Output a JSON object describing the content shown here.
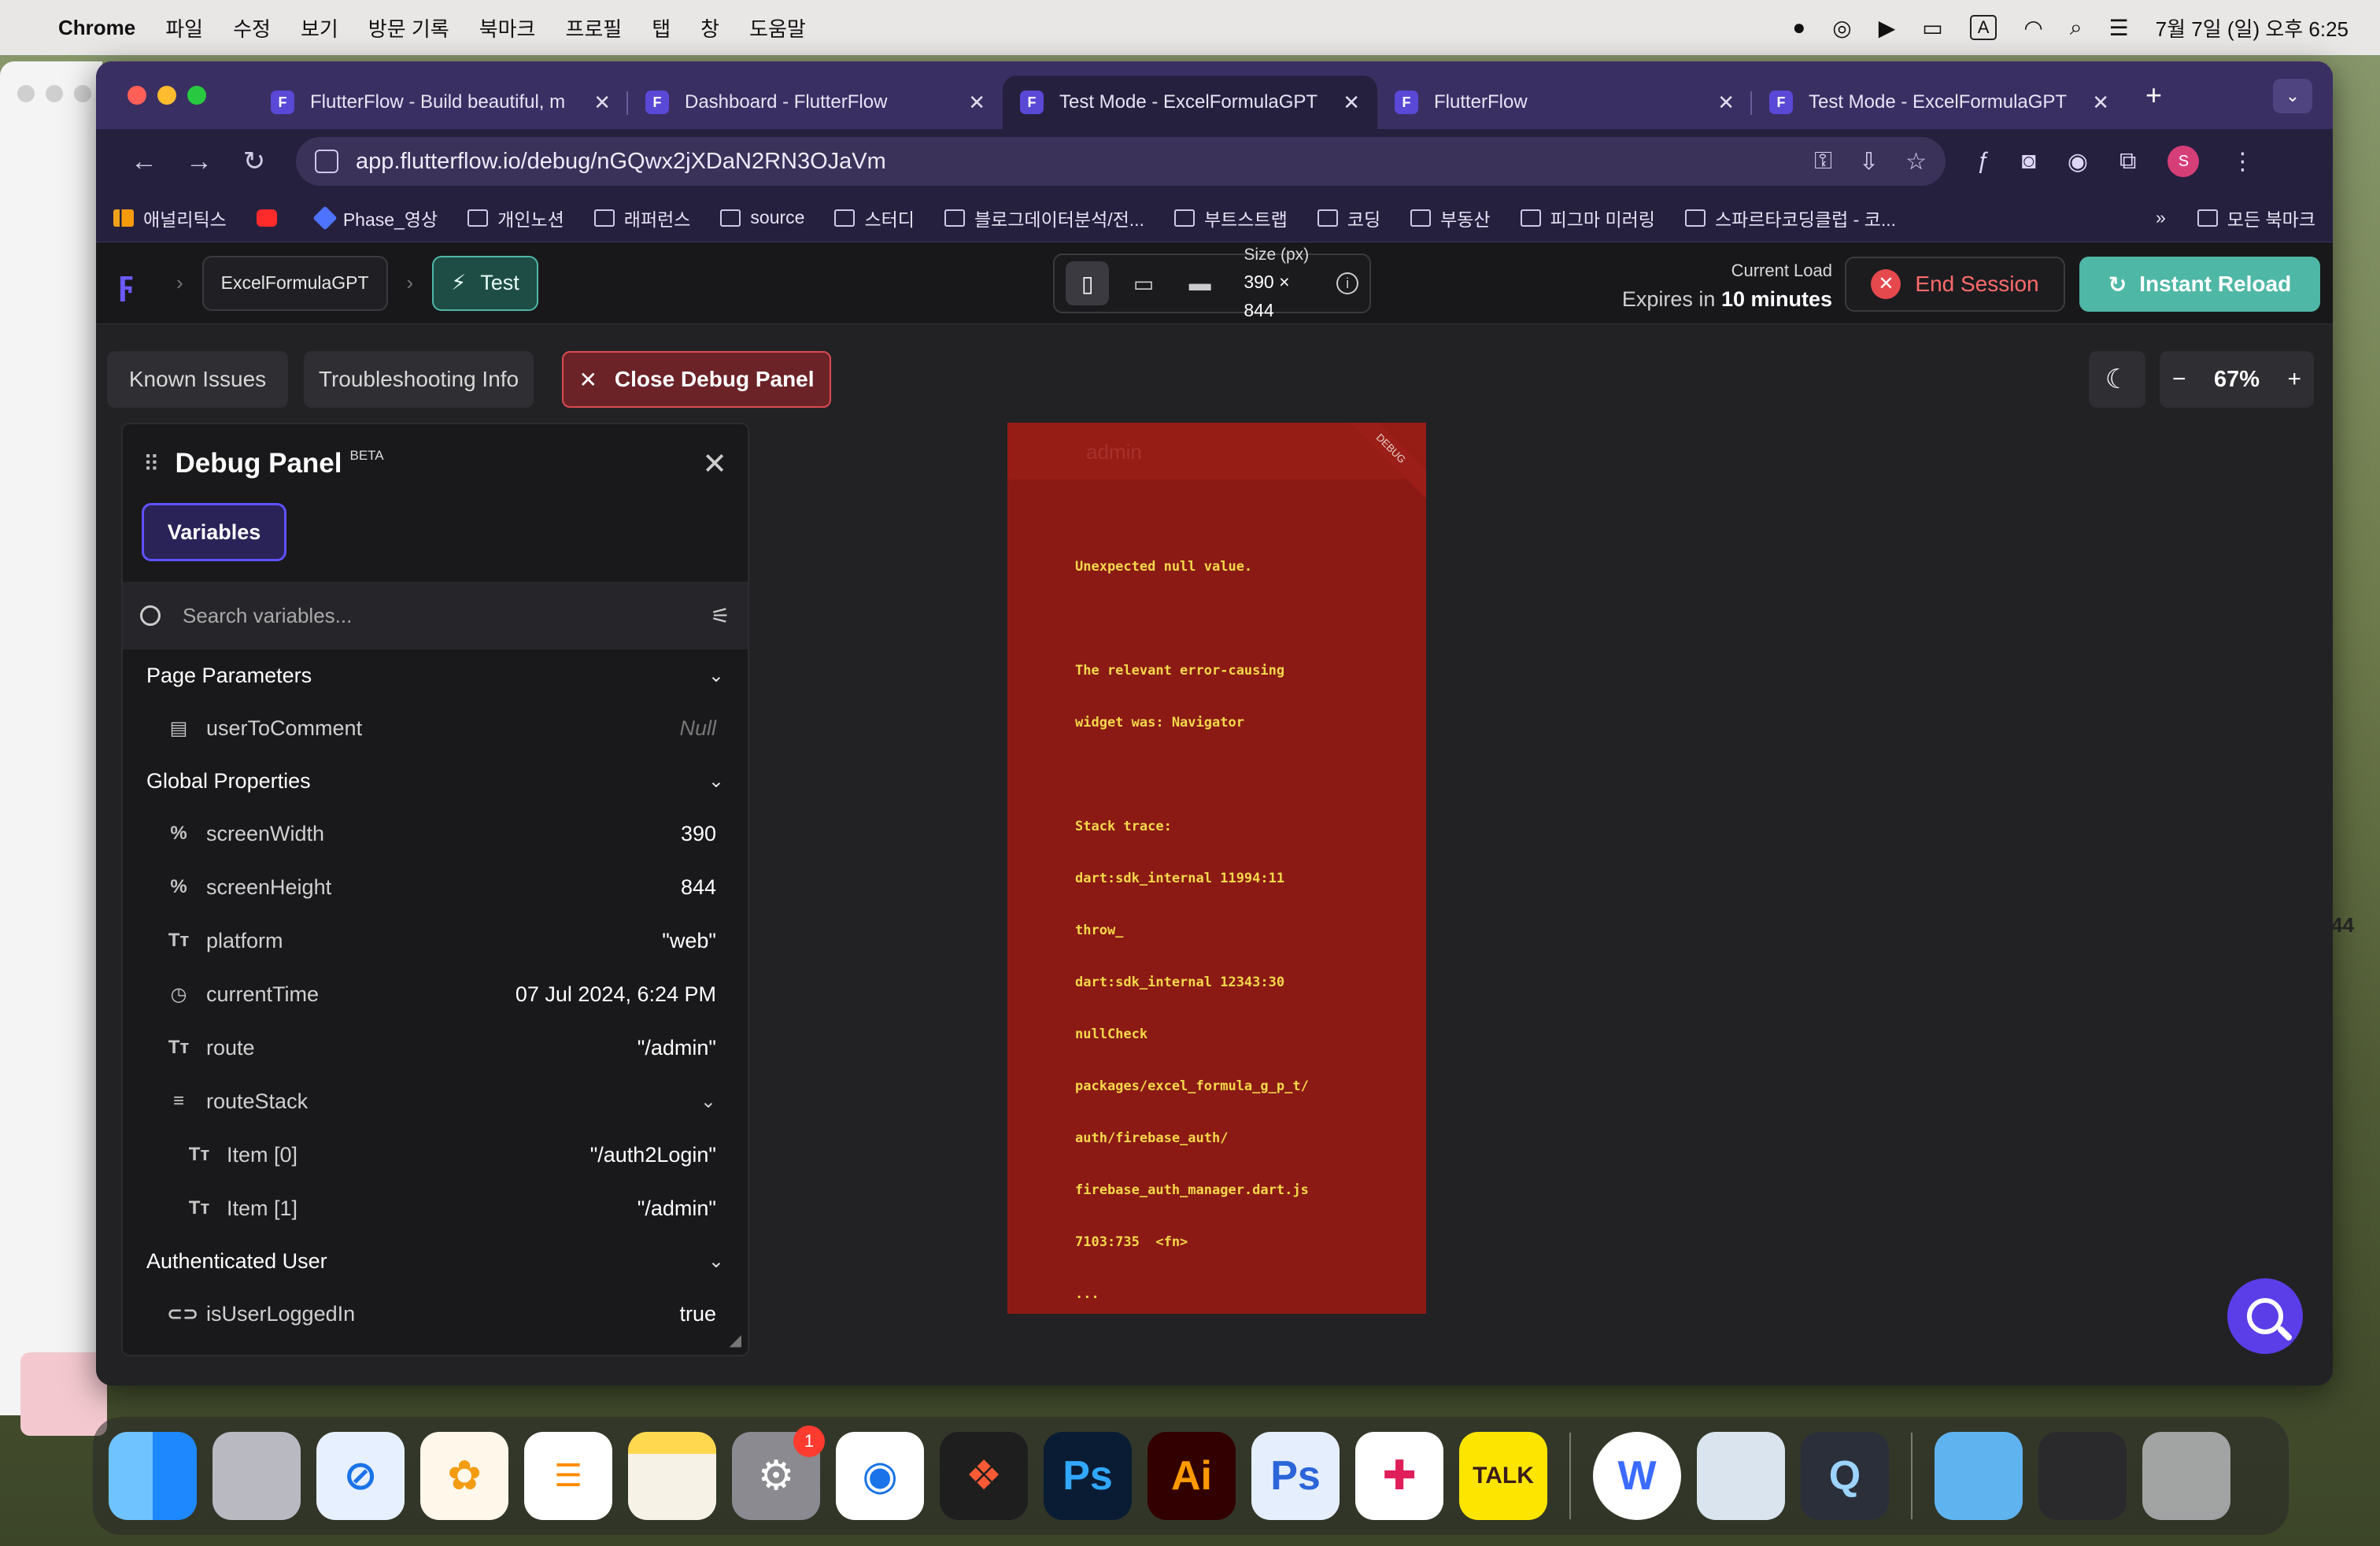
{
  "menubar": {
    "app_name": "Chrome",
    "menus": [
      "파일",
      "수정",
      "보기",
      "방문 기록",
      "북마크",
      "프로필",
      "탭",
      "창",
      "도움말"
    ],
    "input_source": "A",
    "datetime": "7월 7일 (일) 오후 6:25"
  },
  "browser": {
    "tabs": [
      {
        "title": "FlutterFlow - Build beautiful, m"
      },
      {
        "title": "Dashboard - FlutterFlow"
      },
      {
        "title": "Test Mode - ExcelFormulaGPT"
      },
      {
        "title": "FlutterFlow"
      },
      {
        "title": "Test Mode - ExcelFormulaGPT"
      }
    ],
    "url": "app.flutterflow.io/debug/nGQwx2jXDaN2RN3OJaVm",
    "profile_initial": "S",
    "bookmarks": [
      "애널리틱스",
      "",
      "Phase_영상",
      "개인노션",
      "래퍼런스",
      "source",
      "스터디",
      "블로그데이터분석/전...",
      "부트스트랩",
      "코딩",
      "부동산",
      "피그마 미러링",
      "스파르타코딩클럽 - 코..."
    ],
    "bookmarks_overflow": "»",
    "all_bookmarks": "모든 북마크"
  },
  "flutterflow": {
    "project_name": "ExcelFormulaGPT",
    "mode_label": "Test",
    "size_label": "Size (px)",
    "size_value": "390 × 844",
    "current_load_label": "Current Load",
    "expires_prefix": "Expires in",
    "expires_value": "10 minutes",
    "end_session_label": "End Session",
    "instant_reload_label": "Instant Reload",
    "known_issues_label": "Known Issues",
    "troubleshooting_label": "Troubleshooting Info",
    "close_debug_label": "Close Debug Panel",
    "zoom": "67%"
  },
  "debug_panel": {
    "title": "Debug Panel",
    "beta": "BETA",
    "tab_label": "Variables",
    "search_placeholder": "Search variables...",
    "sections": {
      "page_parameters": "Page Parameters",
      "global_properties": "Global Properties",
      "authenticated_user": "Authenticated User"
    },
    "page_params": [
      {
        "name": "userToComment",
        "value": "Null"
      }
    ],
    "globals": [
      {
        "name": "screenWidth",
        "value": "390"
      },
      {
        "name": "screenHeight",
        "value": "844"
      },
      {
        "name": "platform",
        "value": "\"web\""
      },
      {
        "name": "currentTime",
        "value": "07 Jul 2024, 6:24 PM"
      },
      {
        "name": "route",
        "value": "\"/admin\""
      },
      {
        "name": "routeStack",
        "value": ""
      }
    ],
    "route_stack_items": [
      {
        "name": "Item [0]",
        "value": "\"/auth2Login\""
      },
      {
        "name": "Item [1]",
        "value": "\"/admin\""
      }
    ],
    "auth": [
      {
        "name": "isUserLoggedIn",
        "value": "true"
      }
    ]
  },
  "phone": {
    "ghost_title": "admin",
    "debug_ribbon": "DEBUG",
    "error_lines": [
      "Unexpected null value.",
      "",
      "The relevant error-causing",
      "widget was: Navigator",
      "",
      "Stack trace:",
      "dart:sdk_internal 11994:11",
      "throw_",
      "dart:sdk_internal 12343:30",
      "nullCheck",
      "packages/excel_formula_g_p_t/",
      "auth/firebase_auth/",
      "firebase_auth_manager.dart.js",
      "7103:735  <fn>",
      "..."
    ]
  },
  "edge_number": "44",
  "dock": {
    "apps": [
      "finder",
      "launchpad",
      "safari",
      "photos",
      "reminders",
      "notes",
      "system-settings",
      "chrome",
      "figma",
      "photoshop",
      "illustrator",
      "photoshop-beta",
      "slack",
      "kakaotalk",
      "whale",
      "preview",
      "quicktime",
      "folder",
      "screenshot",
      "trash"
    ],
    "settings_badge": "1",
    "labels": {
      "ps": "Ps",
      "ai": "Ai",
      "ps2": "Ps",
      "talk": "TALK",
      "whale": "W"
    }
  },
  "colors": {
    "tab_strip": "#3a2f63",
    "accent_teal": "#4fb7a5",
    "error_red": "#8b1a15",
    "error_text": "#f5d84b",
    "ff_purple": "#5e52ff"
  }
}
